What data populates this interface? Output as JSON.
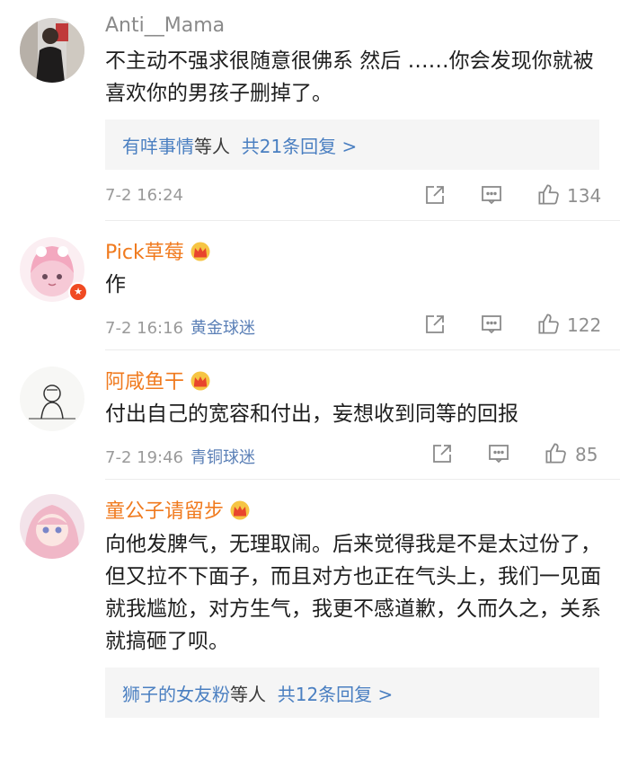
{
  "comments": [
    {
      "username": "Anti__Mama",
      "text": "不主动不强求很随意很佛系 然后 ……你会发现你就被喜欢你的男孩子删掉了。",
      "reply": {
        "name": "有咩事情",
        "mid": "等人",
        "count": "共21条回复 >"
      },
      "time": "7-2 16:24",
      "likes": "134"
    },
    {
      "username": "Pick草莓",
      "text": "作",
      "time": "7-2 16:16",
      "badge": "黄金球迷",
      "likes": "122"
    },
    {
      "username": "阿咸鱼干",
      "text": "付出自己的宽容和付出，妄想收到同等的回报",
      "time": "7-2 19:46",
      "badge": "青铜球迷",
      "likes": "85"
    },
    {
      "username": "童公子请留步",
      "text": "向他发脾气，无理取闹。后来觉得我是不是太过份了，但又拉不下面子，而且对方也正在气头上，我们一见面就我尴尬，对方生气，我更不感道歉，久而久之，关系就搞砸了呗。",
      "reply": {
        "name": "狮子的女友粉",
        "mid": "等人",
        "count": "共12条回复 >"
      }
    }
  ],
  "icons": {
    "share": "share-icon",
    "comment": "comment-icon",
    "like": "thumbs-up-icon",
    "crown": "crown-icon",
    "verified": "verified-badge-icon"
  },
  "colors": {
    "orange_name": "#f07a1e",
    "gray_name": "#8a8a8a",
    "link_blue": "#4a7fc1",
    "meta_gray": "#9a9a9a"
  }
}
